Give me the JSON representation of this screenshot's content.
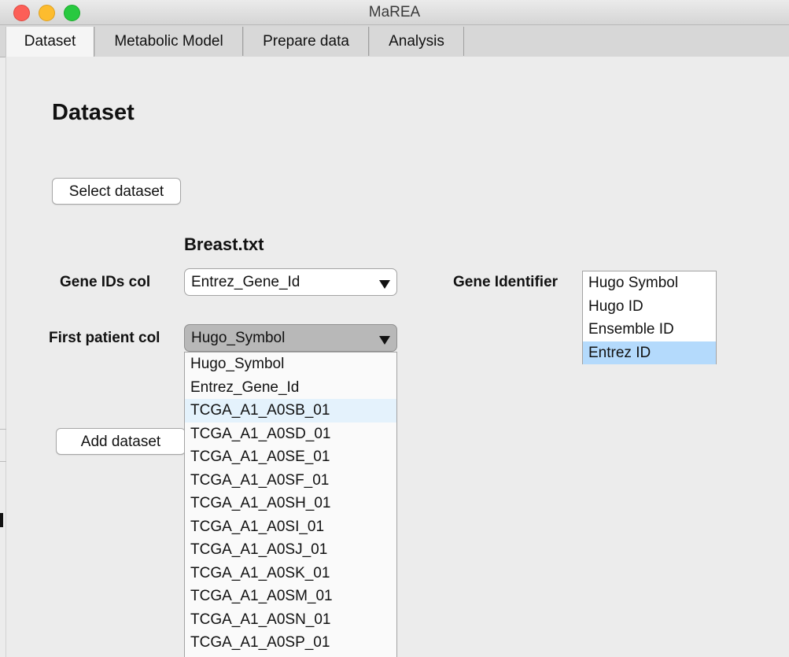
{
  "window": {
    "title": "MaREA"
  },
  "tabs": [
    {
      "label": "Dataset"
    },
    {
      "label": "Metabolic Model"
    },
    {
      "label": "Prepare data"
    },
    {
      "label": "Analysis"
    }
  ],
  "page": {
    "heading": "Dataset",
    "select_button": "Select dataset",
    "file_name": "Breast.txt",
    "gene_ids_label": "Gene IDs col",
    "gene_ids_value": "Entrez_Gene_Id",
    "first_patient_label": "First patient col",
    "first_patient_value": "Hugo_Symbol",
    "gene_identifier_label": "Gene Identifier",
    "add_button": "Add dataset"
  },
  "gene_identifier_options": [
    "Hugo Symbol",
    "Hugo ID",
    "Ensemble ID",
    "Entrez ID"
  ],
  "gene_identifier_selected": "Entrez ID",
  "dropdown_options": [
    "Hugo_Symbol",
    "Entrez_Gene_Id",
    "TCGA_A1_A0SB_01",
    "TCGA_A1_A0SD_01",
    "TCGA_A1_A0SE_01",
    "TCGA_A1_A0SF_01",
    "TCGA_A1_A0SH_01",
    "TCGA_A1_A0SI_01",
    "TCGA_A1_A0SJ_01",
    "TCGA_A1_A0SK_01",
    "TCGA_A1_A0SM_01",
    "TCGA_A1_A0SN_01",
    "TCGA_A1_A0SP_01"
  ],
  "dropdown_hovered": "TCGA_A1_A0SB_01",
  "icons": {
    "dropdown_arrow": "triangle-down-icon"
  }
}
